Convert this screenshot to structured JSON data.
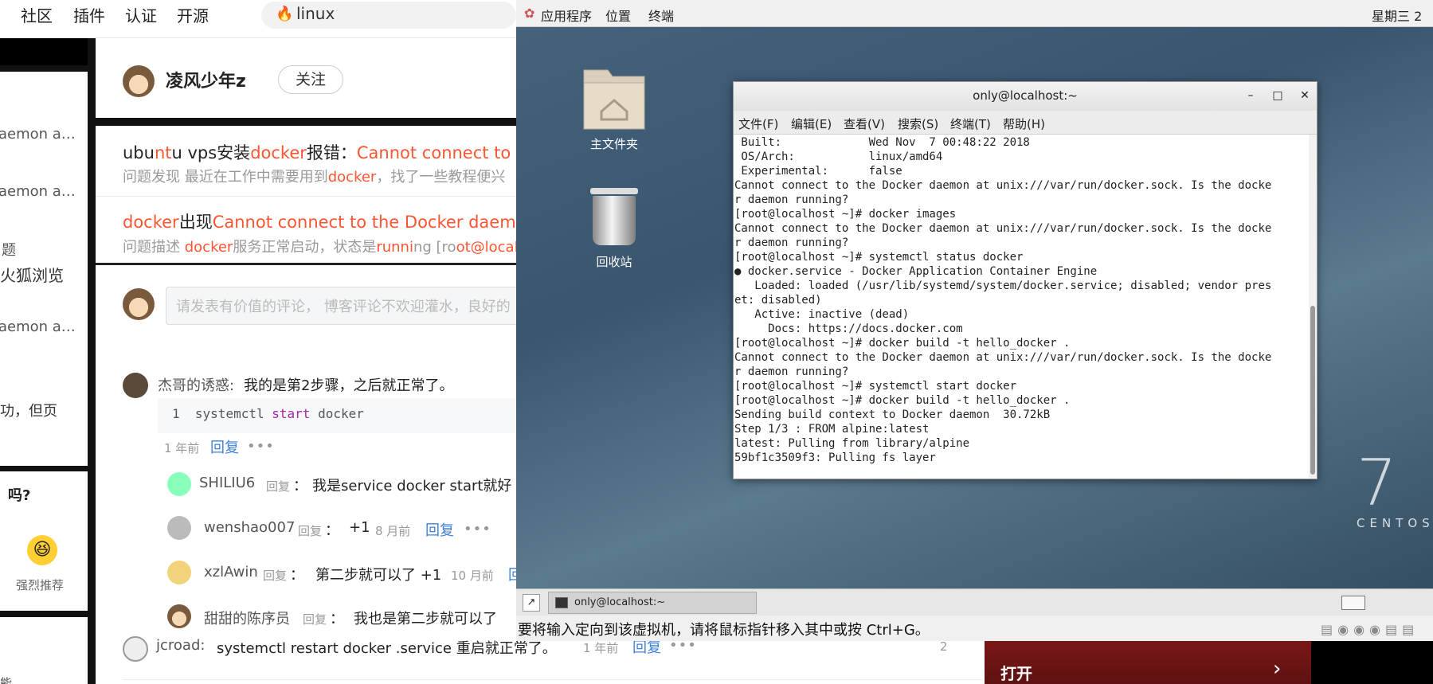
{
  "browser": {
    "nav": [
      "社区",
      "插件",
      "认证",
      "开源"
    ],
    "search_query": "linux"
  },
  "left_sidebar": {
    "snippets": [
      "aemon a…",
      "aemon a…",
      "题",
      "火狐浏览",
      "aemon a…",
      "功，但页"
    ],
    "card_title": "吗?",
    "emoji_label": "强烈推荐",
    "bottom_text": "能"
  },
  "article": {
    "author": "凌风少年z",
    "follow_label": "关注",
    "recommendations": [
      {
        "title_parts": [
          {
            "t": "ubu",
            "hl": false
          },
          {
            "t": "nt",
            "hl": true
          },
          {
            "t": "u vps安装",
            "hl": false
          },
          {
            "t": "docker",
            "hl": true
          },
          {
            "t": "报错：",
            "hl": false
          },
          {
            "t": "Cannot connect to the",
            "hl": true
          }
        ],
        "desc_parts": [
          {
            "t": "问题发现 最近在工作中需要用到",
            "hl": false
          },
          {
            "t": "docker",
            "hl": true
          },
          {
            "t": "，找了一些教程便兴",
            "hl": false
          }
        ]
      },
      {
        "title_parts": [
          {
            "t": "docker",
            "hl": true
          },
          {
            "t": "出现",
            "hl": false
          },
          {
            "t": "Cannot connect to the Docker daemon a",
            "hl": true
          }
        ],
        "desc_parts": [
          {
            "t": "问题描述 ",
            "hl": false
          },
          {
            "t": "docker",
            "hl": true
          },
          {
            "t": "服务正常启动，状态是",
            "hl": false
          },
          {
            "t": "runni",
            "hl": true
          },
          {
            "t": "ng [ro",
            "hl": false
          },
          {
            "t": "ot@local",
            "hl": true
          }
        ]
      }
    ],
    "comment_placeholder": "请发表有价值的评论， 博客评论不欢迎灌水，良好的",
    "comments": {
      "main": {
        "author": "杰哥的诱惑:",
        "text": "我的是第2步骤，之后就正常了。",
        "code_line_no": "1",
        "code_cmd": "systemctl",
        "code_kw": "start",
        "code_arg": "docker",
        "time": "1 年前",
        "reply": "回复",
        "more": "•••"
      },
      "replies": [
        {
          "author": "SHILIU6",
          "tag": "回复",
          "colon": "：",
          "text": "我是service docker start就好",
          "time": "",
          "reply": ""
        },
        {
          "author": "wenshao007",
          "tag": "回复",
          "colon": "：",
          "text": "+1",
          "time": "8 月前",
          "reply": "回复"
        },
        {
          "author": "xzlAwin",
          "tag": "回复",
          "colon": "：",
          "text": "第二步就可以了 +1",
          "time": "10 月前",
          "reply": "回"
        },
        {
          "author": "甜甜的陈序员",
          "tag": "回复",
          "colon": "：",
          "text": "我也是第二步就可以了",
          "time": "",
          "reply": ""
        }
      ],
      "second": {
        "author": "jcroad:",
        "text": "systemctl restart docker .service 重启就正常了。",
        "time": "1 年前",
        "reply": "回复",
        "more": "•••",
        "likes": "2"
      }
    }
  },
  "vm": {
    "topbar": {
      "apps": "应用程序",
      "places": "位置",
      "terminal": "终端",
      "clock": "星期三 2"
    },
    "desktop_icons": [
      {
        "label": "主文件夹",
        "icon": "home-folder-icon"
      },
      {
        "label": "回收站",
        "icon": "trash-icon"
      }
    ],
    "brand_number": "7",
    "brand_text": "CENTOS",
    "terminal": {
      "title": "only@localhost:~",
      "menu": [
        "文件(F)",
        "编辑(E)",
        "查看(V)",
        "搜索(S)",
        "终端(T)",
        "帮助(H)"
      ],
      "lines": [
        " Built:             Wed Nov  7 00:48:22 2018",
        " OS/Arch:           linux/amd64",
        " Experimental:      false",
        "Cannot connect to the Docker daemon at unix:///var/run/docker.sock. Is the docke",
        "r daemon running?",
        "[root@localhost ~]# docker images",
        "Cannot connect to the Docker daemon at unix:///var/run/docker.sock. Is the docke",
        "r daemon running?",
        "[root@localhost ~]# systemctl status docker",
        "● docker.service - Docker Application Container Engine",
        "   Loaded: loaded (/usr/lib/systemd/system/docker.service; disabled; vendor pres",
        "et: disabled)",
        "   Active: inactive (dead)",
        "     Docs: https://docs.docker.com",
        "[root@localhost ~]# docker build -t hello_docker .",
        "Cannot connect to the Docker daemon at unix:///var/run/docker.sock. Is the docke",
        "r daemon running?",
        "[root@localhost ~]# systemctl start docker",
        "[root@localhost ~]# docker build -t hello_docker .",
        "Sending build context to Docker daemon  30.72kB",
        "Step 1/3 : FROM alpine:latest",
        "latest: Pulling from library/alpine",
        "59bf1c3509f3: Pulling fs layer"
      ]
    },
    "taskbar_item": "only@localhost:~",
    "status_message": "要将输入定向到该虚拟机，请将鼠标指针移入其中或按 Ctrl+G。"
  },
  "ad": {
    "label": "打开"
  }
}
